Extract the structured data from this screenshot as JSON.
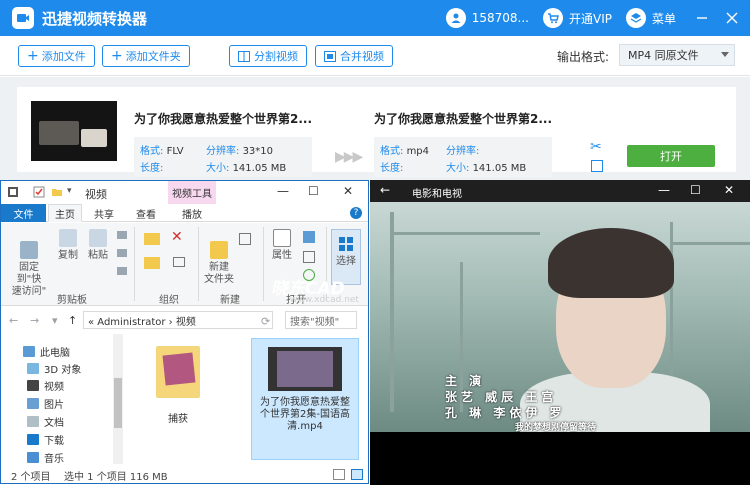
{
  "app": {
    "title": "迅捷视频转换器",
    "user": "158708...",
    "vip": "开通VIP",
    "menu": "菜单"
  },
  "toolbar": {
    "add_file": "添加文件",
    "add_folder": "添加文件夹",
    "split": "分割视频",
    "merge": "合并视频",
    "output_label": "输出格式:",
    "output_value": "MP4  同原文件"
  },
  "file": {
    "source_name": "为了你我愿意热爱整个世界第2...",
    "target_name": "为了你我愿意热爱整个世界第2...",
    "source": {
      "format_label": "格式:",
      "format": "FLV",
      "res_label": "分辨率:",
      "res": "33*10",
      "dur_label": "长度:",
      "dur": "",
      "size_label": "大小:",
      "size": "141.05 MB"
    },
    "target": {
      "format_label": "格式:",
      "format": "mp4",
      "res_label": "分辨率:",
      "res": "",
      "dur_label": "长度:",
      "dur": "",
      "size_label": "大小:",
      "size": "141.05 MB"
    },
    "open_button": "打开"
  },
  "explorer": {
    "folder_title": "视频",
    "tool_tab": "视频工具",
    "tabs": {
      "file": "文件",
      "home": "主页",
      "share": "共享",
      "view": "查看",
      "play": "播放"
    },
    "ribbon": {
      "pin": "固定到\"快\n速访问\"",
      "copy": "复制",
      "paste": "粘贴",
      "new_folder": "新建\n文件夹",
      "properties": "属性",
      "select": "选择",
      "sec_clipboard": "剪贴板",
      "sec_organize": "组织",
      "sec_new": "新建",
      "sec_open": "打开"
    },
    "address": "«  Administrator  ›  视频",
    "search_placeholder": "搜索\"视频\"",
    "sidebar": [
      "此电脑",
      "3D 对象",
      "视频",
      "图片",
      "文档",
      "下载",
      "音乐"
    ],
    "items": [
      {
        "name": "捕获"
      },
      {
        "name": "为了你我愿意热爱整个世界第2集-国语高清.mp4"
      }
    ],
    "status_count": "2 个项目",
    "status_selected": "选中 1 个项目  116 MB"
  },
  "player": {
    "title": "电影和电视",
    "credits": [
      "主 演",
      "张艺  威辰  王宫",
      "孔 琳  李依伊  罗",
      "我的梦想刚停留等待"
    ],
    "watermark": "晓东CAD",
    "watermark_url": "www.xdcad.net"
  },
  "colors": {
    "accent": "#1e8bec",
    "open_green": "#4caf3f",
    "ribbon_file_tab": "#1979ca",
    "tool_tab": "#f7d8ef"
  }
}
